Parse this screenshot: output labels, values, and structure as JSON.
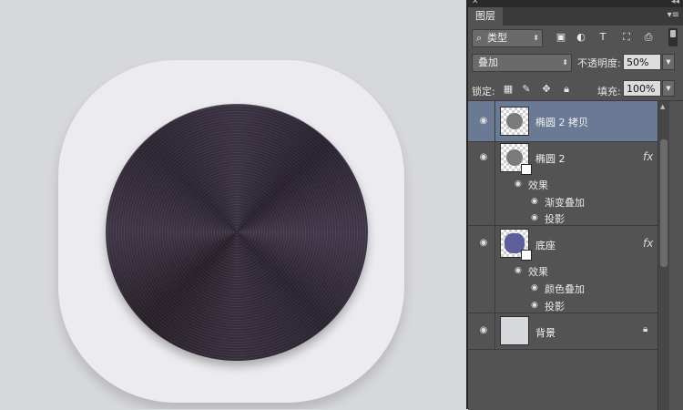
{
  "panel": {
    "close_glyph": "✕",
    "collapse_glyph": "◂◂",
    "tab_label": "图层",
    "menu_glyph": "▾≡"
  },
  "filter": {
    "kind_icon": "search-icon",
    "kind_glyph": "⌕",
    "kind_label": "类型",
    "updown_glyph": "⬍",
    "icons": [
      "image-filter-icon",
      "adjustment-filter-icon",
      "type-filter-icon",
      "shape-filter-icon",
      "smart-object-filter-icon"
    ],
    "glyphs": [
      "▣",
      "◐",
      "T",
      "⛶",
      "⎙"
    ]
  },
  "blend": {
    "mode": "叠加",
    "opacity_label": "不透明度:",
    "opacity_value": "50%",
    "dropdown_glyph": "▼",
    "updown_glyph": "⬍"
  },
  "lock": {
    "label": "锁定:",
    "icons": [
      "lock-transparency-icon",
      "lock-paint-icon",
      "lock-position-icon",
      "lock-all-icon"
    ],
    "glyphs": [
      "▦",
      "✎",
      "✥",
      "🔒︎"
    ],
    "fill_label": "填充:",
    "fill_value": "100%"
  },
  "layers": [
    {
      "name": "椭圆 2 拷贝",
      "selected": true
    },
    {
      "name": "椭圆 2",
      "fx": "fx",
      "effects_label": "效果",
      "effects": [
        "渐变叠加",
        "投影"
      ]
    },
    {
      "name": "底座",
      "fx": "fx",
      "effects_label": "效果",
      "effects": [
        "颜色叠加",
        "投影"
      ]
    },
    {
      "name": "背景",
      "locked": true
    }
  ],
  "glyphs": {
    "eye": "◉",
    "lock": "🔒︎",
    "scroll_up": "▲"
  }
}
